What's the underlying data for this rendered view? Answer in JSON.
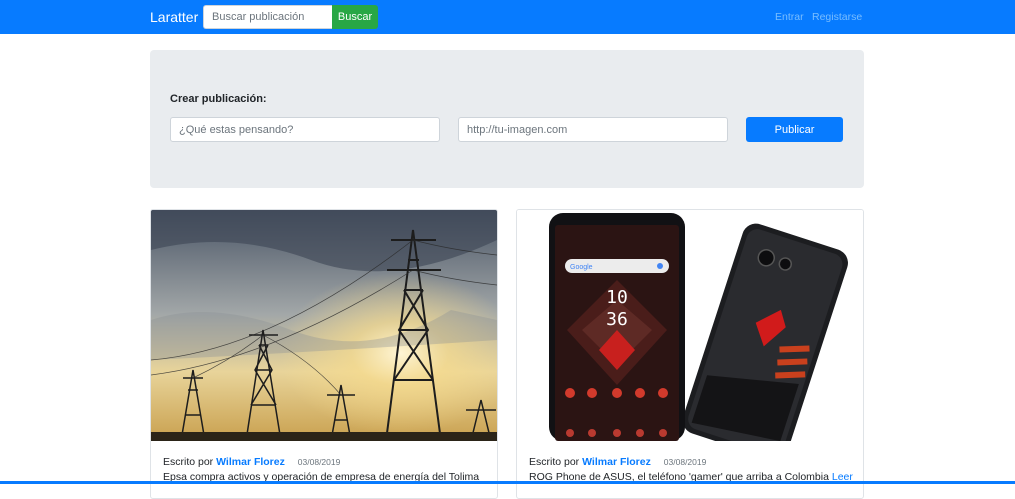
{
  "navbar": {
    "brand": "Laratter",
    "search_placeholder": "Buscar publicación",
    "search_button": "Buscar",
    "login": "Entrar",
    "register": "Registarse"
  },
  "create": {
    "label": "Crear publicación:",
    "content_placeholder": "¿Qué estas pensando?",
    "image_placeholder": "http://tu-imagen.com",
    "publish_button": "Publicar"
  },
  "posts": [
    {
      "written_by": "Escrito por",
      "author": "Wilmar Florez",
      "date": "03/08/2019",
      "text": "Epsa compra activos y operación de empresa de energía del Tolima",
      "link": ""
    },
    {
      "written_by": "Escrito por",
      "author": "Wilmar Florez",
      "date": "03/08/2019",
      "text": "ROG Phone de ASUS, el teléfono 'gamer' que arriba a Colombia",
      "link": "Leer"
    }
  ],
  "phone_screen": {
    "time_hour": "10",
    "time_minute": "36"
  },
  "colors": {
    "primary": "#077bff",
    "success": "#28a745",
    "jumbotron": "#e9ecef"
  }
}
